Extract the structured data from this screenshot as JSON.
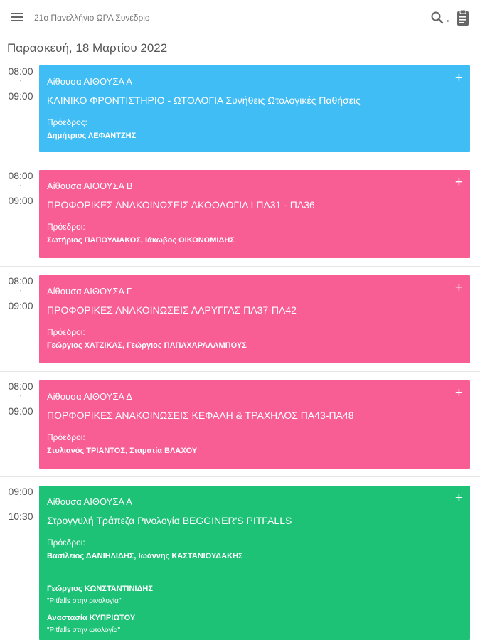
{
  "header": {
    "title": "21ο Πανελλήνιο ΩΡΛ Συνέδριο",
    "icons": [
      "menu-icon",
      "search-icon",
      "clipboard-icon"
    ]
  },
  "day": "Παρασκευή, 18 Μαρτίου 2022",
  "colors": {
    "blue": "#40bdf5",
    "pink": "#f85e94",
    "green": "#1dc277"
  },
  "sessions": [
    {
      "start": "08:00",
      "dash": "-",
      "end": "09:00",
      "room": "Αίθουσα ΑΙΘΟΥΣΑ Α",
      "title": "ΚΛΙΝΙΚΟ ΦΡΟΝΤΙΣΤΗΡΙΟ - ΩΤΟΛΟΓΙΑ Συνήθεις Ωτολογικές Παθήσεις",
      "chair_label": "Πρόεδρος:",
      "chairs": "Δημήτριος ΛΕΦΑΝΤΖΗΣ",
      "plus": "+"
    },
    {
      "start": "08:00",
      "dash": "-",
      "end": "09:00",
      "room": "Αίθουσα ΑΙΘΟΥΣΑ Β",
      "title": "ΠΡΟΦΟΡΙΚΕΣ ΑΝΑΚΟΙΝΩΣΕΙΣ ΑΚΟΟΛΟΓΙΑ Ι ΠΑ31 - ΠΑ36",
      "chair_label": "Πρόεδροι:",
      "chairs": "Σωτήριος ΠΑΠΟΥΛΙΑΚΟΣ, Ιάκωβος ΟΙΚΟΝΟΜΙΔΗΣ",
      "plus": "+"
    },
    {
      "start": "08:00",
      "dash": "-",
      "end": "09:00",
      "room": "Αίθουσα ΑΙΘΟΥΣΑ Γ",
      "title": "ΠΡΟΦΟΡΙΚΕΣ ΑΝΑΚΟΙΝΩΣΕΙΣ ΛΑΡΥΓΓΑΣ ΠΑ37-ΠΑ42",
      "chair_label": "Πρόεδροι:",
      "chairs": "Γεώργιος ΧΑΤΖΙΚΑΣ, Γεώργιος ΠΑΠΑΧΑΡΑΛΑΜΠΟΥΣ",
      "plus": "+"
    },
    {
      "start": "08:00",
      "dash": "-",
      "end": "09:00",
      "room": "Αίθουσα ΑΙΘΟΥΣΑ Δ",
      "title": "ΠΟΡΦΟΡΙΚΕΣ ΑΝΑΚΟΙΝΩΣΕΙΣ ΚΕΦΑΛΗ & ΤΡΑΧΗΛΟΣ ΠΑ43-ΠΑ48",
      "chair_label": "Πρόεδροι:",
      "chairs": "Στυλιανός ΤΡΙΑΝΤΟΣ, Σταματία ΒΛΑΧΟΥ",
      "plus": "+"
    },
    {
      "start": "09:00",
      "dash": "-",
      "end": "10:30",
      "room": "Αίθουσα ΑΙΘΟΥΣΑ Α",
      "title": "Στρογγυλή Τράπεζα Ρινολογία BEGGINER'S PITFALLS",
      "chair_label": "Πρόεδροι:",
      "chairs": "Βασίλειος ΔΑΝΙΗΛΙΔΗΣ, Ιωάννης ΚΑΣΤΑΝΙΟΥΔΑΚΗΣ",
      "plus": "+",
      "speakers": [
        {
          "name": "Γεώργιος ΚΩΝΣΤΑΝΤΙΝΙΔΗΣ",
          "talk": "\"Pitfalls στην ρινολογία\""
        },
        {
          "name": "Αναστασία ΚΥΠΡΙΩΤΟΥ",
          "talk": "\"Pitfalls στην ωτολογία\""
        }
      ]
    }
  ]
}
